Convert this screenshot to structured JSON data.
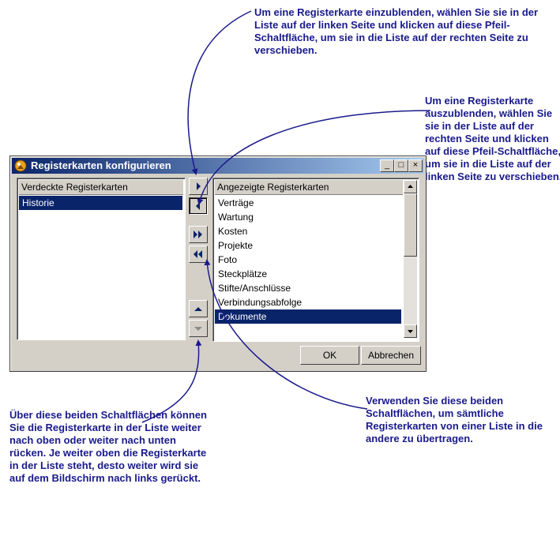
{
  "callouts": {
    "show_tab": "Um eine Registerkarte einzublenden, wählen Sie sie in der Liste auf der linken Seite und klicken auf diese Pfeil-Schaltfläche, um sie in die Liste auf der rechten Seite zu verschieben.",
    "hide_tab": "Um eine Registerkarte auszublenden, wählen Sie sie in der Liste auf der rechten Seite und klicken auf diese Pfeil-Schaltfläche, um sie in die Liste auf der linken Seite zu verschieben.",
    "move_up_down": "Über diese beiden Schaltflächen können Sie die Registerkarte in der Liste weiter nach oben oder weiter nach unten rücken. Je weiter oben die Registerkarte in der Liste steht, desto weiter wird sie auf dem Bildschirm nach links gerückt.",
    "transfer_all": "Verwenden Sie diese beiden Schaltflächen, um sämtliche Registerkarten von einer Liste in die andere zu übertragen."
  },
  "dialog": {
    "title": "Registerkarten konfigurieren",
    "minimize": "_",
    "maximize": "□",
    "close": "×",
    "hidden_list": {
      "header": "Verdeckte Registerkarten",
      "items": [
        "Historie"
      ],
      "selected_index": 0
    },
    "shown_list": {
      "header": "Angezeigte Registerkarten",
      "items": [
        "Verträge",
        "Wartung",
        "Kosten",
        "Projekte",
        "Foto",
        "Steckplätze",
        "Stifte/Anschlüsse",
        "Verbindungsabfolge",
        "Dokumente"
      ],
      "selected_index": 8
    },
    "ok_label": "OK",
    "cancel_label": "Abbrechen"
  },
  "colors": {
    "callout_text": "#1a1a8c",
    "selection": "#0a246a",
    "button_face": "#d4d0c8"
  },
  "icons": [
    "app-icon",
    "arrow-right-icon",
    "arrow-left-icon",
    "double-arrow-right-icon",
    "double-arrow-left-icon",
    "arrow-up-icon",
    "arrow-down-icon"
  ]
}
